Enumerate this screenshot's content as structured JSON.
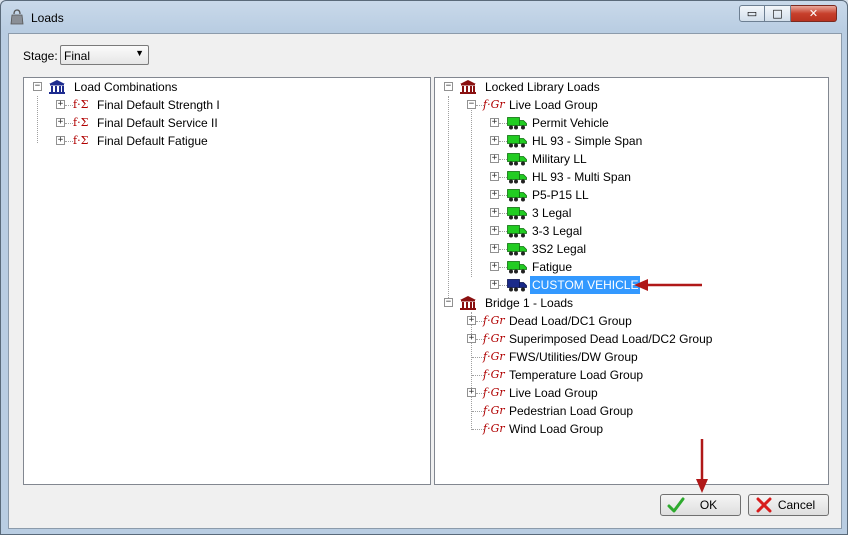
{
  "window": {
    "title": "Loads",
    "minimize_glyph": "▭",
    "maximize_glyph": "□",
    "close_glyph": "✕"
  },
  "stage": {
    "label": "Stage:",
    "value": "Final",
    "arrow_glyph": "▼"
  },
  "left_tree": {
    "root": {
      "label": "Load Combinations"
    },
    "items": [
      {
        "label": "Final Default Strength I"
      },
      {
        "label": "Final Default Service II"
      },
      {
        "label": "Final Default Fatigue"
      }
    ]
  },
  "right_tree": {
    "library": {
      "label": "Locked Library Loads",
      "group": {
        "label": "Live Load Group"
      },
      "vehicles": [
        {
          "label": "Permit Vehicle",
          "icon": "green-truck-icon"
        },
        {
          "label": "HL 93 - Simple Span",
          "icon": "green-truck-icon"
        },
        {
          "label": "Military LL",
          "icon": "green-truck-icon"
        },
        {
          "label": "HL 93 - Multi Span",
          "icon": "green-truck-icon"
        },
        {
          "label": "P5-P15 LL",
          "icon": "green-truck-icon"
        },
        {
          "label": "3 Legal",
          "icon": "green-truck-icon"
        },
        {
          "label": "3-3 Legal",
          "icon": "green-truck-icon"
        },
        {
          "label": "3S2 Legal",
          "icon": "green-truck-icon"
        },
        {
          "label": "Fatigue",
          "icon": "green-truck-icon"
        },
        {
          "label": "CUSTOM VEHICLE",
          "icon": "blue-truck-icon"
        }
      ]
    },
    "bridge": {
      "label": "Bridge 1 - Loads",
      "groups": [
        {
          "label": "Dead Load/DC1 Group",
          "expandable": true
        },
        {
          "label": "Superimposed Dead Load/DC2 Group",
          "expandable": true
        },
        {
          "label": "FWS/Utilities/DW Group",
          "expandable": false
        },
        {
          "label": "Temperature Load Group",
          "expandable": false
        },
        {
          "label": "Live Load Group",
          "expandable": true
        },
        {
          "label": "Pedestrian Load Group",
          "expandable": false
        },
        {
          "label": "Wind Load Group",
          "expandable": false
        }
      ]
    }
  },
  "tree_glyphs": {
    "expand": "+",
    "collapse": "−",
    "group_prefix": "f·Gr",
    "combo_prefix": "f·Σ"
  },
  "buttons": {
    "ok": "OK",
    "cancel": "Cancel"
  },
  "colors": {
    "selection": "#3399ff",
    "annotation_arrow": "#b01818",
    "group_prefix": "#b00000"
  }
}
